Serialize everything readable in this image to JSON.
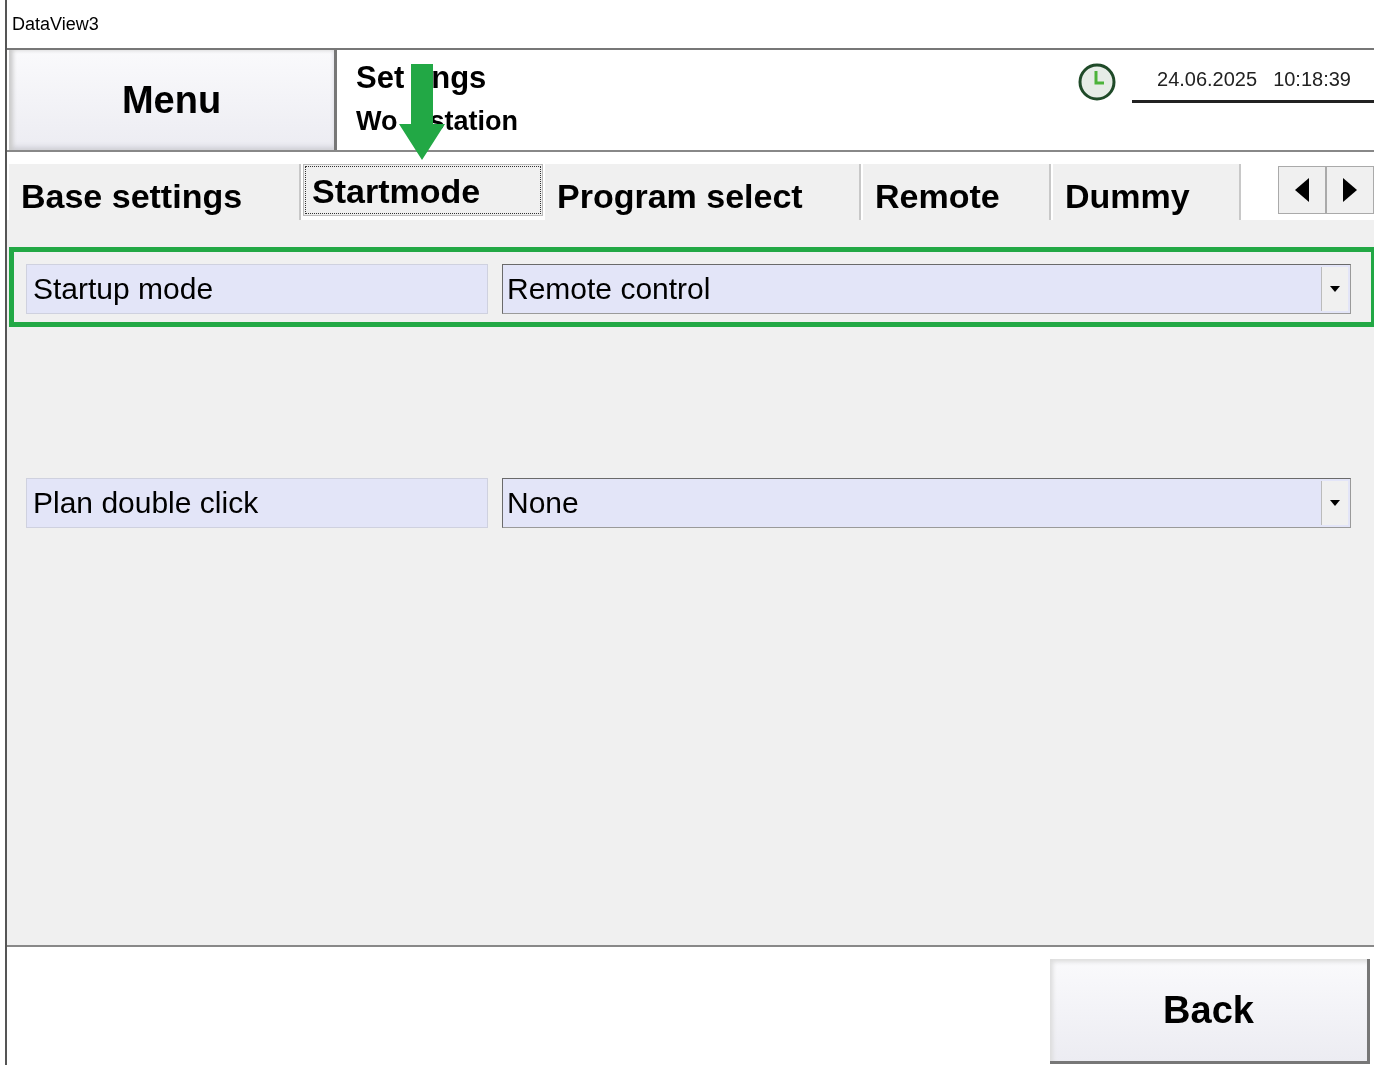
{
  "window": {
    "title": "DataView3"
  },
  "header": {
    "menu_button": "Menu",
    "title_parts": [
      "Set",
      "ngs"
    ],
    "subtitle_parts": [
      "Wo",
      "station"
    ],
    "date": "24.06.2025",
    "time": "10:18:39"
  },
  "tabs": [
    {
      "label": "Base settings",
      "selected": false
    },
    {
      "label": "Startmode",
      "selected": true
    },
    {
      "label": "Program select",
      "selected": false
    },
    {
      "label": "Remote",
      "selected": false
    },
    {
      "label": "Dummy",
      "selected": false
    }
  ],
  "settings": [
    {
      "label": "Startup mode",
      "value": "Remote control",
      "highlighted": true
    },
    {
      "label": "Plan double click",
      "value": "None",
      "highlighted": false
    }
  ],
  "footer": {
    "back_button": "Back"
  }
}
